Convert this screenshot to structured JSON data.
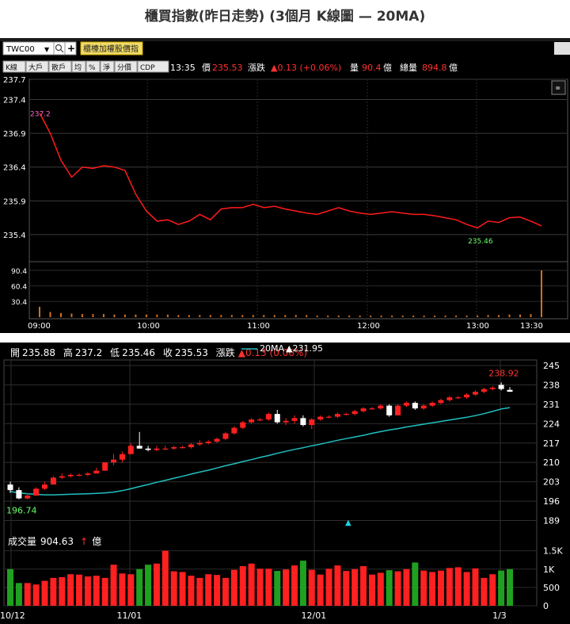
{
  "page_title": "櫃買指數(昨日走勢) (3個月 K線圖  — 20MA)",
  "intraday": {
    "symbol": "TWC00",
    "name_button": "櫃檯加權股價指",
    "tabs": [
      "K線",
      "大戶",
      "散戶",
      "均",
      "%",
      "淨",
      "分價",
      "CDP"
    ],
    "time": "13:35",
    "price_label": "價",
    "price": "235.53",
    "change_label": "漲跌",
    "change": "▲0.13 (+0.06%)",
    "volume_label": "量",
    "volume": "90.4",
    "volume_unit": "億",
    "total_label": "總量",
    "total": "894.8",
    "total_unit": "億",
    "colors": {
      "line": "#ff1a1a",
      "up": "#ff2020",
      "volume": "#d07020",
      "text": "#ffffff",
      "low": "#66ff66",
      "high": "#ff66cc"
    }
  },
  "daily_header": {
    "open_label": "開",
    "open": "235.88",
    "high_label": "高",
    "high": "237.2",
    "low_label": "低",
    "low": "235.46",
    "close_label": "收",
    "close": "235.53",
    "change_label": "漲跌",
    "change": "▲0.13 (0.06%)",
    "ma_label": "20MA",
    "ma_value": "▲231.95",
    "volume_label": "成交量",
    "volume_value": "904.63",
    "volume_unit": "億"
  },
  "chart_data": [
    {
      "type": "line",
      "title": "",
      "x_ticks": [
        "09:00",
        "10:00",
        "11:00",
        "12:00",
        "13:00",
        "13:30"
      ],
      "y_ticks": [
        237.7,
        237.4,
        236.9,
        236.4,
        235.9,
        235.4
      ],
      "ylim": [
        235.0,
        237.7
      ],
      "open_price": 237.2,
      "low_price": 235.46,
      "series": [
        {
          "values": [
            237.2,
            236.9,
            236.5,
            236.25,
            236.4,
            236.38,
            236.42,
            236.4,
            236.35,
            236.0,
            235.75,
            235.6,
            235.62,
            235.55,
            235.6,
            235.7,
            235.62,
            235.78,
            235.8,
            235.8,
            235.85,
            235.8,
            235.82,
            235.78,
            235.75,
            235.72,
            235.7,
            235.75,
            235.8,
            235.75,
            235.72,
            235.7,
            235.72,
            235.74,
            235.72,
            235.7,
            235.7,
            235.68,
            235.65,
            235.62,
            235.55,
            235.5,
            235.6,
            235.58,
            235.65,
            235.66,
            235.6,
            235.53
          ]
        }
      ],
      "volume_ticks": [
        90.4,
        60.4,
        30.4
      ],
      "volume_values": [
        20,
        10,
        8,
        7,
        6,
        6,
        6,
        5,
        5,
        5,
        5,
        5,
        5,
        4,
        4,
        4,
        4,
        4,
        4,
        4,
        4,
        4,
        4,
        4,
        4,
        4,
        3,
        3,
        3,
        3,
        3,
        3,
        3,
        3,
        3,
        3,
        3,
        3,
        3,
        3,
        3,
        3,
        4,
        4,
        5,
        5,
        6,
        90.4
      ]
    },
    {
      "type": "candlestick",
      "title": "",
      "x_ticks": [
        "10/12",
        "11/01",
        "12/01",
        "1/3"
      ],
      "y_ticks": [
        245,
        238,
        231,
        224,
        217,
        210,
        203,
        196,
        189
      ],
      "ylim": [
        186,
        247
      ],
      "max_label": "238.92",
      "min_label": "196.74",
      "candles": [
        [
          202,
          203,
          199,
          200
        ],
        [
          200,
          201,
          196.7,
          197
        ],
        [
          197,
          199,
          196.7,
          198
        ],
        [
          198,
          201,
          198,
          200.5
        ],
        [
          200.5,
          203,
          200,
          202
        ],
        [
          202,
          205,
          202,
          204.5
        ],
        [
          204.5,
          206,
          204,
          205
        ],
        [
          205,
          206,
          204.5,
          205.5
        ],
        [
          205.5,
          206,
          205,
          205.5
        ],
        [
          205.5,
          206.5,
          205,
          206
        ],
        [
          206,
          208,
          206,
          207
        ],
        [
          207,
          210,
          207,
          210
        ],
        [
          210,
          213,
          209,
          211
        ],
        [
          211,
          214,
          210,
          213
        ],
        [
          213,
          217,
          213,
          216
        ],
        [
          216,
          221,
          215,
          215
        ],
        [
          215,
          216,
          214,
          214.5
        ],
        [
          214.5,
          216,
          214,
          215
        ],
        [
          215,
          216,
          214.5,
          215
        ],
        [
          215,
          216,
          214.5,
          215.5
        ],
        [
          215.5,
          216,
          215,
          215.5
        ],
        [
          215.5,
          217,
          215,
          216.5
        ],
        [
          216.5,
          218,
          216,
          217
        ],
        [
          217,
          218,
          216.5,
          217.5
        ],
        [
          217.5,
          219,
          217,
          218.5
        ],
        [
          218.5,
          221,
          218,
          220.5
        ],
        [
          220.5,
          223,
          220,
          222.5
        ],
        [
          222.5,
          225,
          222,
          224.5
        ],
        [
          224.5,
          226,
          224,
          225.5
        ],
        [
          225.5,
          226,
          225,
          225.5
        ],
        [
          225.5,
          228,
          225,
          227.5
        ],
        [
          227.5,
          229,
          224,
          224.5
        ],
        [
          224.5,
          226,
          223.5,
          225
        ],
        [
          225,
          227,
          224,
          226
        ],
        [
          226,
          227,
          223,
          223.5
        ],
        [
          223.5,
          226,
          222,
          225.5
        ],
        [
          225.5,
          227,
          225,
          226.5
        ],
        [
          226.5,
          227,
          226,
          226.5
        ],
        [
          226.5,
          228,
          226,
          227.5
        ],
        [
          227.5,
          228,
          227,
          227.5
        ],
        [
          227.5,
          229,
          227,
          228.5
        ],
        [
          228.5,
          230,
          228,
          229.5
        ],
        [
          229.5,
          230,
          229,
          229.5
        ],
        [
          229.5,
          231,
          229,
          230.5
        ],
        [
          230.5,
          231,
          226.5,
          227
        ],
        [
          227,
          231,
          227,
          230.5
        ],
        [
          230.5,
          232,
          230,
          231.5
        ],
        [
          231.5,
          232,
          229,
          229.5
        ],
        [
          229.5,
          231,
          229,
          230.5
        ],
        [
          230.5,
          232,
          230,
          231.5
        ],
        [
          231.5,
          233,
          231,
          232.5
        ],
        [
          232.5,
          234,
          232,
          233.5
        ],
        [
          233.5,
          234,
          233,
          233.5
        ],
        [
          233.5,
          235,
          233,
          234.5
        ],
        [
          234.5,
          236,
          234,
          235.5
        ],
        [
          235.5,
          237,
          235,
          236.5
        ],
        [
          236.5,
          237.5,
          236,
          237
        ],
        [
          238,
          238.9,
          236,
          236.5
        ],
        [
          236.2,
          237.2,
          235.46,
          235.53
        ]
      ],
      "ma20": [
        199.5,
        199,
        198.7,
        198.5,
        198.3,
        198.3,
        198.4,
        198.5,
        198.6,
        198.7,
        198.8,
        199,
        199.3,
        199.8,
        200.5,
        201.3,
        202,
        202.8,
        203.5,
        204.3,
        205,
        205.8,
        206.5,
        207.2,
        208,
        208.8,
        209.5,
        210.3,
        211,
        211.8,
        212.5,
        213.3,
        214,
        214.7,
        215.3,
        216,
        216.6,
        217.3,
        218,
        218.6,
        219.2,
        219.8,
        220.5,
        221.1,
        221.7,
        222.2,
        222.8,
        223.3,
        223.8,
        224.3,
        224.8,
        225.3,
        225.8,
        226.3,
        226.9,
        227.6,
        228.4,
        229.3,
        229.8
      ],
      "volume_ticks": [
        "1.5K",
        "1K",
        "500",
        "0"
      ],
      "volume_ylim": [
        0,
        1600
      ],
      "volumes": [
        1000,
        620,
        620,
        580,
        680,
        760,
        780,
        860,
        850,
        800,
        820,
        760,
        1120,
        880,
        860,
        1000,
        1120,
        1150,
        1500,
        940,
        920,
        820,
        760,
        860,
        840,
        760,
        980,
        1080,
        1150,
        1010,
        1010,
        950,
        990,
        1100,
        1230,
        980,
        850,
        1010,
        1100,
        950,
        1000,
        1080,
        850,
        900,
        970,
        940,
        1000,
        1180,
        960,
        920,
        960,
        1030,
        1050,
        920,
        1020,
        760,
        860,
        960,
        1000
      ]
    }
  ]
}
